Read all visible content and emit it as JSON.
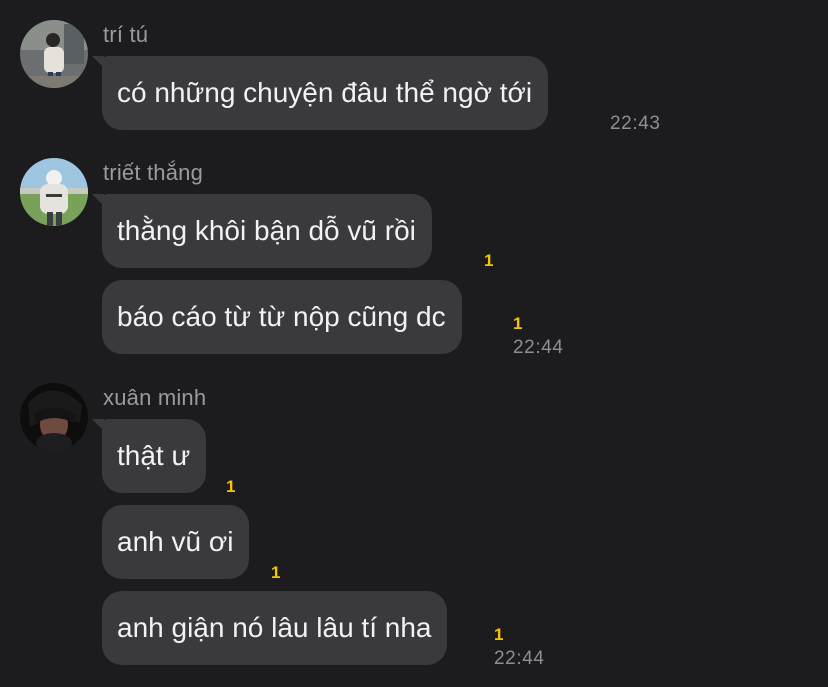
{
  "chat": {
    "groups": [
      {
        "sender": "trí tú",
        "avatar_icon": "user-avatar-photo-icon",
        "messages": [
          {
            "text": "có những chuyện đâu thể ngờ tới",
            "reaction": "",
            "time": "22:43"
          }
        ]
      },
      {
        "sender": "triết thắng",
        "avatar_icon": "user-avatar-photo-icon",
        "messages": [
          {
            "text": "thằng khôi bận dỗ vũ rồi",
            "reaction": "1",
            "time": ""
          },
          {
            "text": "báo cáo từ từ nộp cũng dc",
            "reaction": "1",
            "time": "22:44"
          }
        ]
      },
      {
        "sender": "xuân minh",
        "avatar_icon": "user-avatar-photo-icon",
        "messages": [
          {
            "text": "thật ư",
            "reaction": "1",
            "time": ""
          },
          {
            "text": "anh vũ ơi",
            "reaction": "1",
            "time": ""
          },
          {
            "text": "anh giận nó lâu lâu tí nha",
            "reaction": "1",
            "time": "22:44"
          }
        ]
      }
    ]
  },
  "colors": {
    "background": "#1c1c1e",
    "bubble": "#3a3a3c",
    "reaction": "#f5c400",
    "timestamp": "#8e8e93"
  }
}
